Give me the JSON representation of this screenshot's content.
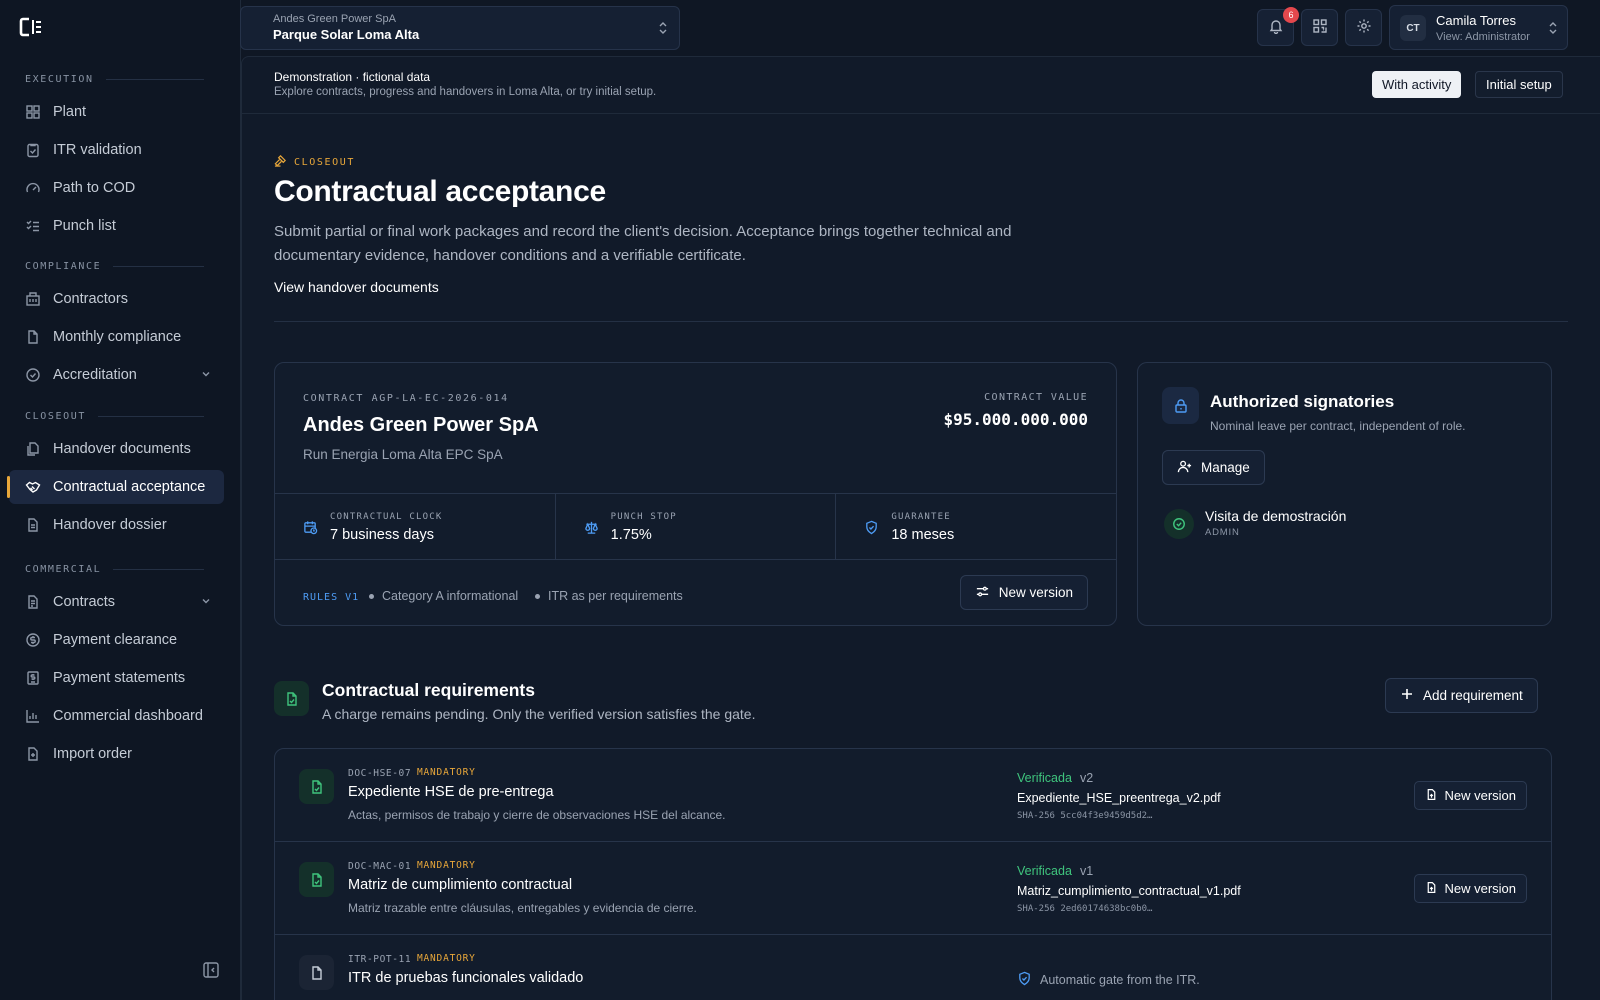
{
  "sidebar": {
    "sections": [
      {
        "heading": "EXECUTION",
        "items": [
          {
            "label": "Plant",
            "icon": "grid-icon"
          },
          {
            "label": "ITR validation",
            "icon": "clipboard-check-icon"
          },
          {
            "label": "Path to COD",
            "icon": "gauge-icon"
          },
          {
            "label": "Punch list",
            "icon": "list-check-icon"
          }
        ]
      },
      {
        "heading": "COMPLIANCE",
        "items": [
          {
            "label": "Contractors",
            "icon": "building-icon"
          },
          {
            "label": "Monthly compliance",
            "icon": "file-icon"
          },
          {
            "label": "Accreditation",
            "icon": "check-circle-icon"
          }
        ]
      },
      {
        "heading": "CLOSEOUT",
        "items": [
          {
            "label": "Handover documents",
            "icon": "files-icon"
          },
          {
            "label": "Contractual acceptance",
            "icon": "handshake-icon"
          },
          {
            "label": "Handover dossier",
            "icon": "document-icon"
          }
        ]
      },
      {
        "heading": "COMMERCIAL",
        "items": [
          {
            "label": "Contracts",
            "icon": "file-text-icon"
          },
          {
            "label": "Payment clearance",
            "icon": "dollar-circle-icon"
          },
          {
            "label": "Payment statements",
            "icon": "receipt-icon"
          },
          {
            "label": "Commercial dashboard",
            "icon": "bar-chart-icon"
          },
          {
            "label": "Import order",
            "icon": "file-plus-icon"
          }
        ]
      }
    ],
    "active_item": "Contractual acceptance"
  },
  "topbar": {
    "org": "Andes Green Power SpA",
    "project": "Parque Solar Loma Alta",
    "notifications_count": "6",
    "user_initials": "CT",
    "user_name": "Camila Torres",
    "user_role": "View: Administrator"
  },
  "demo": {
    "title": "Demonstration · fictional data",
    "subtitle": "Explore contracts, progress and handovers in Loma Alta, or try initial setup.",
    "btn_activity": "With activity",
    "btn_setup": "Initial setup"
  },
  "header": {
    "eyebrow": "CLOSEOUT",
    "title": "Contractual acceptance",
    "description": "Submit partial or final work packages and record the client's decision. Acceptance brings together technical and documentary evidence, handover conditions and a verifiable certificate.",
    "link": "View handover documents"
  },
  "contract": {
    "code": "CONTRACT AGP-LA-EC-2026-014",
    "name": "Andes Green Power SpA",
    "epc": "Run Energia Loma Alta EPC SpA",
    "value_label": "CONTRACT VALUE",
    "value": "$95.000.000.000",
    "metrics": [
      {
        "label": "CONTRACTUAL CLOCK",
        "value": "7 business days"
      },
      {
        "label": "PUNCH STOP",
        "value": "1.75%"
      },
      {
        "label": "GUARANTEE",
        "value": "18 meses"
      }
    ],
    "rules_label": "RULES V1",
    "rule_1": "Category A informational",
    "rule_2": "ITR as per requirements",
    "new_version": "New version"
  },
  "signatories": {
    "title": "Authorized signatories",
    "subtitle": "Nominal leave per contract, independent of role.",
    "manage": "Manage",
    "person": "Visita de demostración",
    "person_role": "ADMIN"
  },
  "requirements": {
    "title": "Contractual requirements",
    "subtitle": "A charge remains pending. Only the verified version satisfies the gate.",
    "add": "Add requirement",
    "rows": [
      {
        "code": "DOC-HSE-07",
        "tag": "MANDATORY",
        "name": "Expediente HSE de pre-entrega",
        "desc": "Actas, permisos de trabajo y cierre de observaciones HSE del alcance.",
        "status": "Verificada",
        "version": "v2",
        "file": "Expediente_HSE_preentrega_v2.pdf",
        "hash": "SHA-256 5cc04f3e9459d5d2…",
        "action": "New version"
      },
      {
        "code": "DOC-MAC-01",
        "tag": "MANDATORY",
        "name": "Matriz de cumplimiento contractual",
        "desc": "Matriz trazable entre cláusulas, entregables y evidencia de cierre.",
        "status": "Verificada",
        "version": "v1",
        "file": "Matriz_cumplimiento_contractual_v1.pdf",
        "hash": "SHA-256 2ed60174638bc0b0…",
        "action": "New version"
      },
      {
        "code": "ITR-POT-11",
        "tag": "MANDATORY",
        "name": "ITR de pruebas funcionales validado",
        "gate": "Automatic gate from the ITR."
      }
    ]
  },
  "colors": {
    "accent": "#e8a73a",
    "info": "#4e9cf5",
    "success": "#3fc47d",
    "danger": "#e5484d"
  }
}
